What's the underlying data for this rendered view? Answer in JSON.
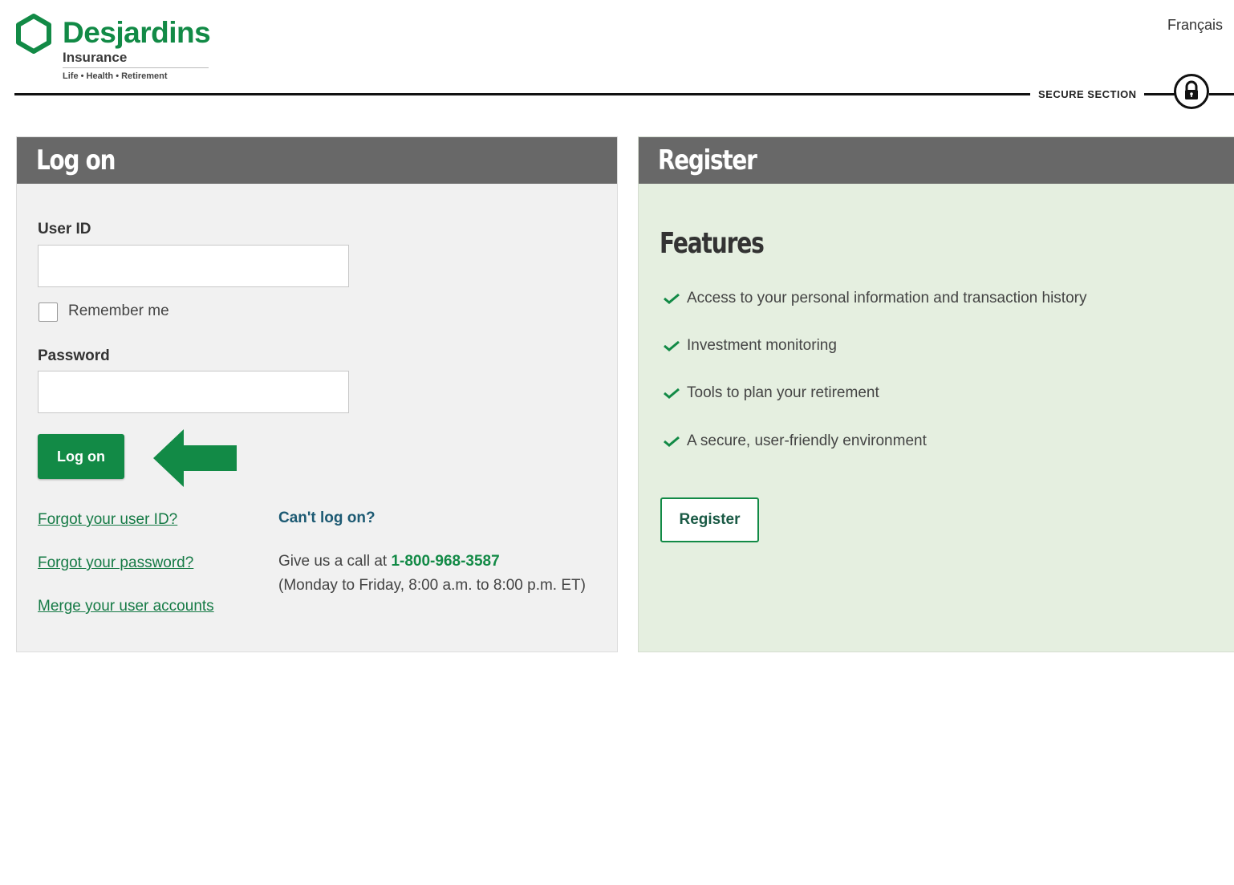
{
  "header": {
    "brand_name": "Desjardins",
    "brand_sub": "Insurance",
    "brand_tagline": "Life • Health • Retirement",
    "language_link": "Français",
    "secure_section_label": "SECURE SECTION"
  },
  "logon": {
    "title": "Log on",
    "user_id_label": "User ID",
    "user_id_value": "",
    "remember_me_label": "Remember me",
    "remember_me_checked": false,
    "password_label": "Password",
    "password_value": "",
    "logon_button": "Log on",
    "links": {
      "forgot_user_id": "Forgot your user ID?",
      "forgot_password": "Forgot your password?",
      "merge_accounts": "Merge your user accounts"
    },
    "help": {
      "title": "Can't log on?",
      "call_prefix": "Give us a call at ",
      "phone": "1-800-968-3587",
      "hours": "(Monday to Friday, 8:00 a.m. to 8:00 p.m. ET)"
    }
  },
  "register": {
    "title": "Register",
    "features_title": "Features",
    "features": [
      "Access to your personal information and transaction history",
      "Investment monitoring",
      "Tools to plan your retirement",
      "A secure, user-friendly environment"
    ],
    "register_button": "Register"
  },
  "colors": {
    "brand_green": "#128a46",
    "panel_header": "#686868",
    "register_bg": "#e5efe0",
    "logon_bg": "#f1f1f1"
  },
  "icons": [
    "desjardins-hexagon-logo-icon",
    "lock-icon",
    "arrow-left-icon",
    "checkmark-icon"
  ]
}
